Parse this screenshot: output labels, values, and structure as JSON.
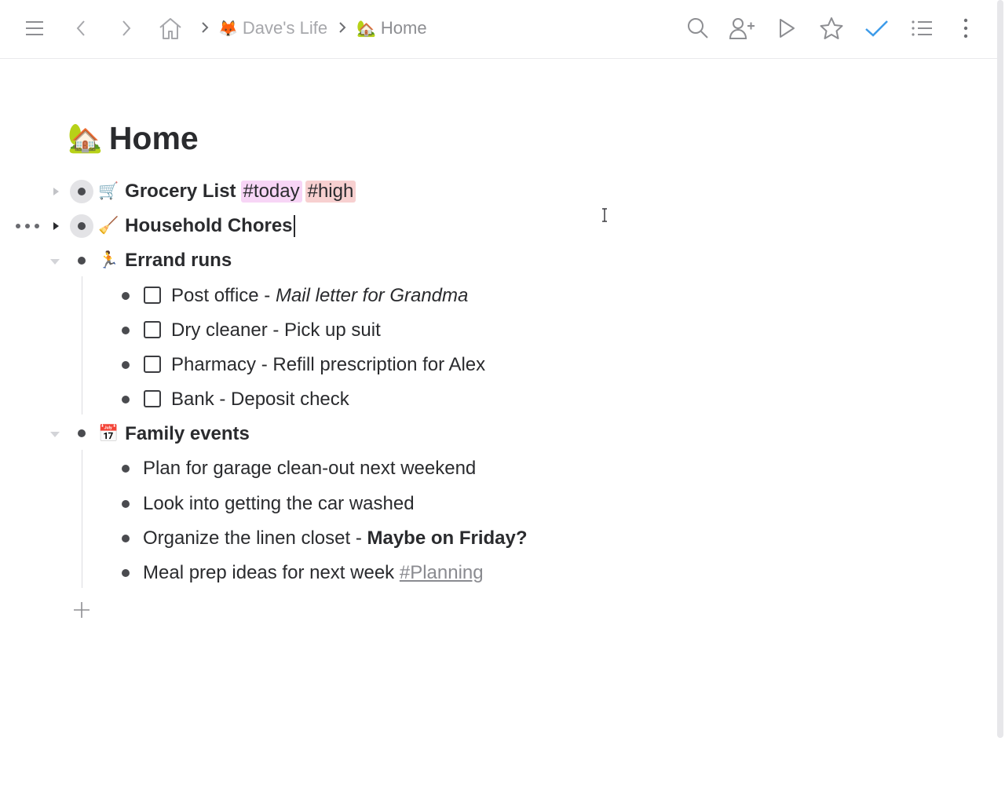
{
  "breadcrumb": {
    "workspace": {
      "emoji": "🦊",
      "label": "Dave's Life"
    },
    "page": {
      "emoji": "🏡",
      "label": "Home"
    }
  },
  "page": {
    "emoji": "🏡",
    "title": "Home"
  },
  "items": [
    {
      "emoji": "🛒",
      "label": "Grocery List",
      "collapsed": true,
      "tags": [
        {
          "text": "#today",
          "color": "#f7d5f6"
        },
        {
          "text": "#high",
          "color": "#f7d0d0"
        }
      ]
    },
    {
      "emoji": "🧹",
      "label": "Household Chores",
      "collapsed": true
    },
    {
      "emoji": "🏃",
      "label": "Errand runs",
      "collapsed": false,
      "children": [
        {
          "checked": false,
          "text": "Post office - ",
          "emphasis": "Mail letter for Grandma"
        },
        {
          "checked": false,
          "text": "Dry cleaner - Pick up suit"
        },
        {
          "checked": false,
          "text": "Pharmacy - Refill prescription for Alex"
        },
        {
          "checked": false,
          "text": "Bank - Deposit check"
        }
      ]
    },
    {
      "emoji": "📅",
      "label": "Family events",
      "collapsed": false,
      "children": [
        {
          "text": "Plan for garage clean-out next weekend"
        },
        {
          "text": "Look into getting the car washed"
        },
        {
          "text": "Organize the linen closet - ",
          "bold": "Maybe on Friday?"
        },
        {
          "text": "Meal prep ideas for next week ",
          "tag": "#Planning"
        }
      ]
    }
  ],
  "colors": {
    "accent_check": "#3d9be9",
    "tag_today": "#f7d5f6",
    "tag_high": "#f7d0d0",
    "text": "#2a2b2e",
    "icon": "#8d8e92"
  },
  "icons": [
    "menu-icon",
    "back-icon",
    "forward-icon",
    "home-icon",
    "search-icon",
    "add-person-icon",
    "play-icon",
    "star-icon",
    "check-icon",
    "list-icon",
    "more-vertical-icon"
  ]
}
